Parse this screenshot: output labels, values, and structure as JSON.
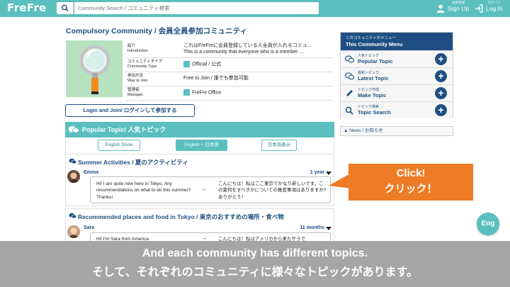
{
  "header": {
    "logo": "FreFre",
    "search_placeholder": "Community Search / コミュニティ検索",
    "signup_small": "会員登録",
    "signup_label": "Sign Up",
    "login_small": "ログイン",
    "login_label": "Log In"
  },
  "community": {
    "title": "Compulsory Community / 会員全員参加コミュニティ",
    "rows": [
      {
        "label_jp": "紹介",
        "label_en": "Introduction",
        "value1": "これはFreFreに会員登録している人全員が入れるコミュ...",
        "value2": "This is a community that everyone who is a member ..."
      },
      {
        "label_jp": "コミュニティタイプ",
        "label_en": "Community Type",
        "value1": "Official / 公式"
      },
      {
        "label_jp": "参加方法",
        "label_en": "Way to Join",
        "value1": "Free to Join / 誰でも参加可能"
      },
      {
        "label_jp": "管理者",
        "label_en": "Manager",
        "value1": "FreFre Office"
      }
    ],
    "join_button": "Login and Join/ ログインして参加する"
  },
  "popular": {
    "title": "Popular Topic/ 人気トピック",
    "lang_buttons": [
      "English Show",
      "English + 日本語",
      "日本語表示"
    ]
  },
  "topics": [
    {
      "title": "Summer Activities / 夏のアクティビティ",
      "author": "Emma",
      "age": "1 year",
      "en": "Hi! I am quite new here in Tokyo. Any recommendations on what to do this summer? Thanks!",
      "arrow": "↔",
      "jp": "こんにちは！私はここ東京でかなり新しいです。この夏何をすべきかについての推奨事項はありますか?ありがとう！"
    },
    {
      "title": "Recommended places and food in Tokyo / 東京のおすすめの場所・食べ物",
      "author": "Sara",
      "age": "11 months",
      "en": "Hi! I'm Sara from America.",
      "arrow": "↔",
      "jp": "こんにちは！私はアメリカから来たサラで"
    }
  ],
  "menu": {
    "head_small": "このコミュニティのメニュー",
    "head_big": "This Community Menu",
    "items": [
      {
        "small": "人気トピック",
        "big": "Popular Topic",
        "icon": "speech-bubbles-icon"
      },
      {
        "small": "最新トピック",
        "big": "Latest Topic",
        "icon": "speech-bubbles-icon"
      },
      {
        "small": "トピック作成",
        "big": "Make Topic",
        "icon": "pencil-icon"
      },
      {
        "small": "トピック検索",
        "big": "Topic Search",
        "icon": "search-icon"
      }
    ],
    "plus": "+"
  },
  "news": {
    "label": "▲ News / お知らせ"
  },
  "callout": {
    "line1": "Click!",
    "line2": "クリック！"
  },
  "eng_button": "Eng",
  "caption": {
    "line1": "And each community has different topics.",
    "line2": "そして、それぞれのコミュニティに様々なトピックがあります。"
  },
  "colors": {
    "teal": "#5bbfbf",
    "navy": "#1f4f82",
    "orange": "#ee7b25",
    "caption_gray": "#a5a5a5"
  }
}
